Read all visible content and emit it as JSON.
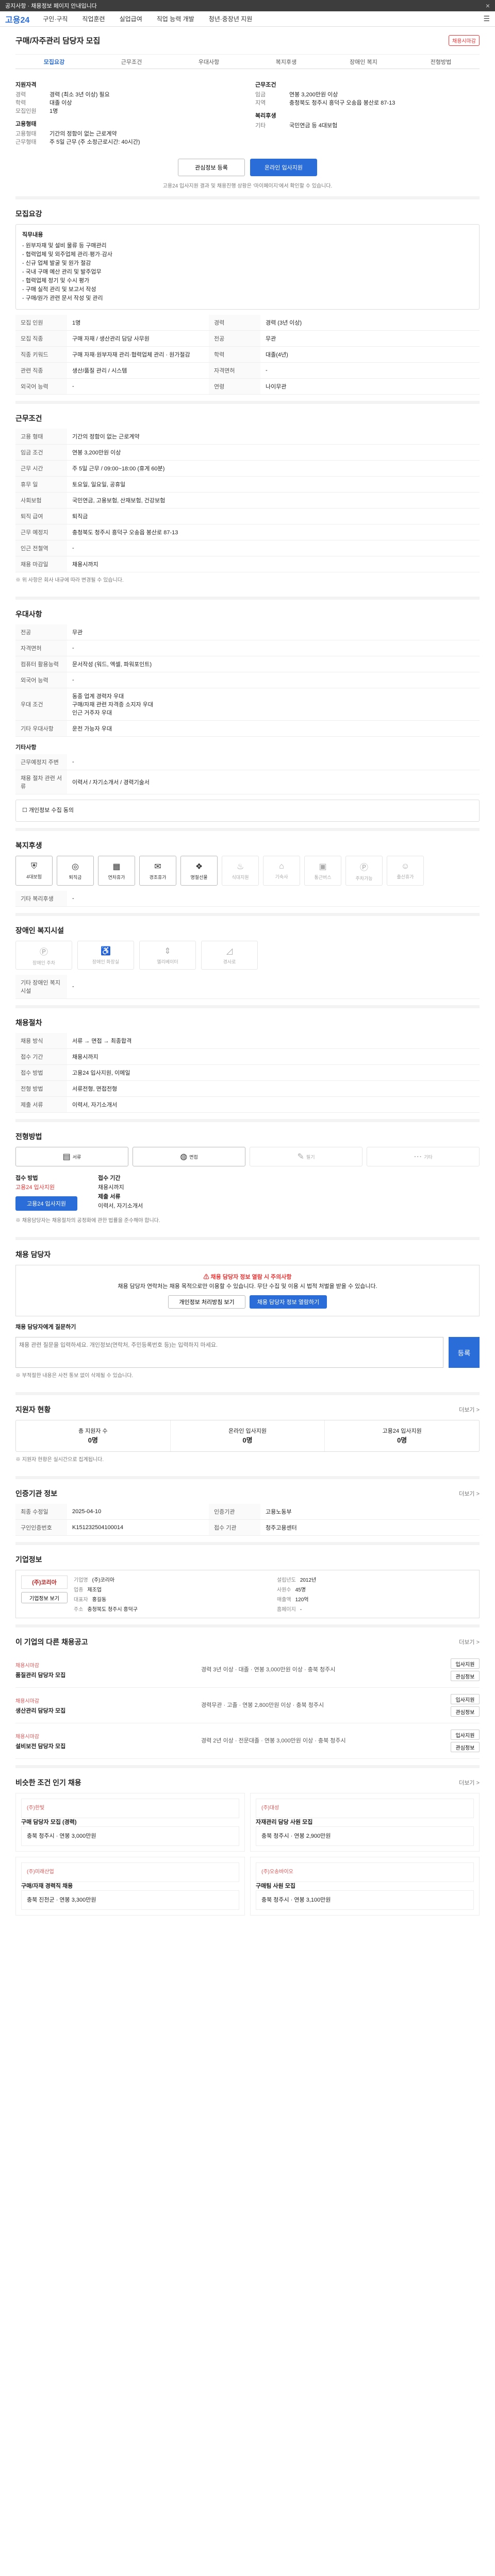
{
  "notice": {
    "text": "공지사항 · 채용정보 페이지 안내입니다",
    "close": "×"
  },
  "header": {
    "logo": "고용24",
    "nav": [
      "구인·구직",
      "직업훈련",
      "실업급여",
      "직업 능력 개발",
      "청년·중장년 지원"
    ],
    "sitemap": "☰"
  },
  "job": {
    "title": "구매/자주관리 담당자 모집",
    "badge": "채용시마감"
  },
  "tabs": [
    "모집요강",
    "근무조건",
    "우대사항",
    "복지후생",
    "장애인 복지",
    "전형방법"
  ],
  "summary": {
    "left_label": "지원자격",
    "left": [
      [
        "경력",
        "경력 (최소 3년 이상) 필요"
      ],
      [
        "학력",
        "대졸 이상"
      ],
      [
        "모집인원",
        "1명"
      ]
    ],
    "left2_label": "고용형태",
    "left2": [
      [
        "고용형태",
        "기간의 정함이 없는 근로계약"
      ],
      [
        "근무형태",
        "주 5일 근무 (주 소정근로시간: 40시간)"
      ]
    ],
    "right_label": "근무조건",
    "right": [
      [
        "임금",
        "연봉 3,200만원 이상"
      ],
      [
        "지역",
        "충청북도 청주시 흥덕구 오송읍 봉산로 87-13"
      ]
    ],
    "right2_label": "복리후생",
    "right2": [
      [
        "기타",
        "국민연금 등 4대보험"
      ]
    ]
  },
  "actions": {
    "apply": "온라인 입사지원",
    "scrap": "관심정보 등록"
  },
  "apply_note": "고용24 입사지원 결과 및 채용진행 상황은 ‘마이페이지’에서 확인할 수 있습니다.",
  "s1": {
    "title": "모집요강",
    "desc_title": "직무내용",
    "desc": "- 원부자재 및 설비 물류 등 구매관리\n- 협력업체 및 외주업체 관리·평가·감사\n- 신규 업체 발굴 및 원가 절감\n- 국내 구매 예산 관리 및 발주업무\n- 협력업체 정기 및 수시 평가\n- 구매 실적 관리 및 보고서 작성\n- 구매/원가 관련 문서 작성 및 관리",
    "rows": [
      [
        "모집 인원",
        "1명",
        "경력",
        "경력 (3년 이상)"
      ],
      [
        "모집 직종",
        "구매 자재 / 생산관리 담당 사무원",
        "전공",
        "무관"
      ],
      [
        "직종 키워드",
        "구매 자재·원부자재 관리·협력업체 관리 · 원가절감",
        "학력",
        "대졸(4년)"
      ],
      [
        "관련 직종",
        "생산/품질 관리 / 시스템",
        "자격면허",
        "-"
      ],
      [
        "외국어 능력",
        "-",
        "연령",
        "나이무관"
      ]
    ]
  },
  "s2": {
    "title": "근무조건",
    "rows": [
      [
        "고용 형태",
        "기간의 정함이 없는 근로계약"
      ],
      [
        "임금 조건",
        "연봉 3,200만원 이상"
      ],
      [
        "근무 시간",
        "주 5일 근무 / 09:00~18:00 (휴게 60분)"
      ],
      [
        "휴무 일",
        "토요일, 일요일, 공휴일"
      ],
      [
        "사회보험",
        "국민연금, 고용보험, 산재보험, 건강보험"
      ],
      [
        "퇴직 급여",
        "퇴직금"
      ],
      [
        "근무 예정지",
        "충청북도 청주시 흥덕구 오송읍 봉산로 87-13"
      ],
      [
        "인근 전철역",
        "-"
      ],
      [
        "채용 마감일",
        "채용시까지"
      ]
    ],
    "pay_note": "※ 위 사항은 회사 내규에 따라 변경될 수 있습니다."
  },
  "s3": {
    "title": "우대사항",
    "rows": [
      [
        "전공",
        "무관"
      ],
      [
        "자격면허",
        "-"
      ],
      [
        "컴퓨터 활용능력",
        "문서작성 (워드, 엑셀, 파워포인트)"
      ],
      [
        "외국어 능력",
        "-"
      ],
      [
        "우대 조건",
        "동종 업계 경력자 우대\n구매/자재 관련 자격증 소지자 우대\n인근 거주자 우대"
      ],
      [
        "기타 우대사항",
        "운전 가능자 우대"
      ]
    ],
    "etc_title": "기타사항",
    "etc": [
      [
        "근무예정지 주변",
        "-"
      ],
      [
        "채용 절차 관련 서류",
        "이력서 / 자기소개서 / 경력기술서"
      ]
    ],
    "agree": "개인정보 수집 동의"
  },
  "s4": {
    "title": "복지후생",
    "icons": [
      "4대보험",
      "퇴직금",
      "연차휴가",
      "경조휴가",
      "명절선물",
      "식대지원",
      "기숙사",
      "통근버스",
      "주차가능",
      "출산휴가"
    ],
    "on": [
      0,
      1,
      2,
      3,
      4
    ],
    "etc_label": "기타 복리후생",
    "etc": "-"
  },
  "s5": {
    "title": "장애인 복지시설",
    "icons": [
      "장애인 주차",
      "장애인 화장실",
      "엘리베이터",
      "경사로"
    ],
    "etc_label": "기타 장애인 복지시설",
    "etc": "-"
  },
  "s6": {
    "title": "채용절차",
    "rows": [
      [
        "채용 방식",
        "서류 → 면접 → 최종합격"
      ],
      [
        "접수 기간",
        "채용시까지"
      ],
      [
        "접수 방법",
        "고용24 입사지원, 이메일"
      ],
      [
        "전형 방법",
        "서류전형, 면접전형"
      ],
      [
        "제출 서류",
        "이력서, 자기소개서"
      ]
    ]
  },
  "s7": {
    "title": "전형방법",
    "buttons": [
      "서류",
      "면접",
      "필기",
      "기타"
    ],
    "on": [
      0,
      1
    ],
    "apply_label": "접수 방법",
    "apply_val": "고용24 입사지원",
    "period_label": "접수 기간",
    "period_val": "채용시까지",
    "doc_label": "제출 서류",
    "doc_val": "이력서, 자기소개서",
    "apply_btn": "고용24 입사지원",
    "note": "※ 채용담당자는 채용절차의 공정화에 관한 법률을 준수해야 합니다."
  },
  "s8": {
    "title": "채용 담당자",
    "warn_title": "채용 담당자 정보 열람 시 주의사항",
    "warn": "채용 담당자 연락처는 채용 목적으로만 이용할 수 있습니다. 무단 수집 및 이용 시 법적 처벌을 받을 수 있습니다.",
    "btn1": "개인정보 처리방침 보기",
    "btn2": "채용 담당자 정보 열람하기",
    "qa_label": "채용 담당자에게 질문하기",
    "qa_placeholder": "채용 관련 질문을 입력하세요. 개인정보(연락처, 주민등록번호 등)는 입력하지 마세요.",
    "qa_btn": "등록",
    "qa_note": "※ 부적절한 내용은 사전 통보 없이 삭제될 수 있습니다."
  },
  "s9": {
    "title": "지원자 현황",
    "more": "더보기 >",
    "stats": [
      [
        "총 지원자 수",
        "0명"
      ],
      [
        "온라인 입사지원",
        "0명"
      ],
      [
        "고용24 입사지원",
        "0명"
      ]
    ],
    "note": "※ 지원자 현황은 실시간으로 집계됩니다."
  },
  "s10": {
    "title": "인증기관 정보",
    "more": "더보기 >",
    "rows": [
      [
        "최종 수정일",
        "2025-04-10"
      ],
      [
        "인증기관",
        "고용노동부"
      ],
      [
        "구인인증번호",
        "K151232504100014"
      ],
      [
        "접수 기관",
        "청주고용센터"
      ]
    ]
  },
  "s11": {
    "title": "기업정보",
    "logo": "(주)코리아",
    "btn": "기업정보 보기",
    "info": [
      [
        "기업명",
        "(주)코리아"
      ],
      [
        "설립년도",
        "2012년"
      ],
      [
        "업종",
        "제조업"
      ],
      [
        "사원수",
        "45명"
      ],
      [
        "대표자",
        "홍길동"
      ],
      [
        "매출액",
        "120억"
      ],
      [
        "주소",
        "충청북도 청주시 흥덕구"
      ],
      [
        "홈페이지",
        "-"
      ]
    ]
  },
  "s12": {
    "title": "이 기업의 다른 채용공고",
    "more": "더보기 >",
    "jobs": [
      {
        "co": "채용시마감",
        "title": "품질관리 담당자 모집",
        "meta": "경력 3년 이상 · 대졸 · 연봉 3,000만원 이상 · 충북 청주시",
        "b1": "입사지원",
        "b2": "관심정보"
      },
      {
        "co": "채용시마감",
        "title": "생산관리 담당자 모집",
        "meta": "경력무관 · 고졸 · 연봉 2,800만원 이상 · 충북 청주시",
        "b1": "입사지원",
        "b2": "관심정보"
      },
      {
        "co": "채용시마감",
        "title": "설비보전 담당자 모집",
        "meta": "경력 2년 이상 · 전문대졸 · 연봉 3,000만원 이상 · 충북 청주시",
        "b1": "입사지원",
        "b2": "관심정보"
      }
    ]
  },
  "s13": {
    "title": "비슷한 조건 인기 채용",
    "more": "더보기 >",
    "jobs": [
      {
        "co": "(주)한빛",
        "title": "구매 담당자 모집 (경력)",
        "meta": "충북 청주시 · 연봉 3,000만원"
      },
      {
        "co": "(주)대성",
        "title": "자재관리 담당 사원 모집",
        "meta": "충북 청주시 · 연봉 2,900만원"
      },
      {
        "co": "(주)미래산업",
        "title": "구매/자재 경력직 채용",
        "meta": "충북 진천군 · 연봉 3,300만원"
      },
      {
        "co": "(주)오송바이오",
        "title": "구매팀 사원 모집",
        "meta": "충북 청주시 · 연봉 3,100만원"
      }
    ]
  }
}
